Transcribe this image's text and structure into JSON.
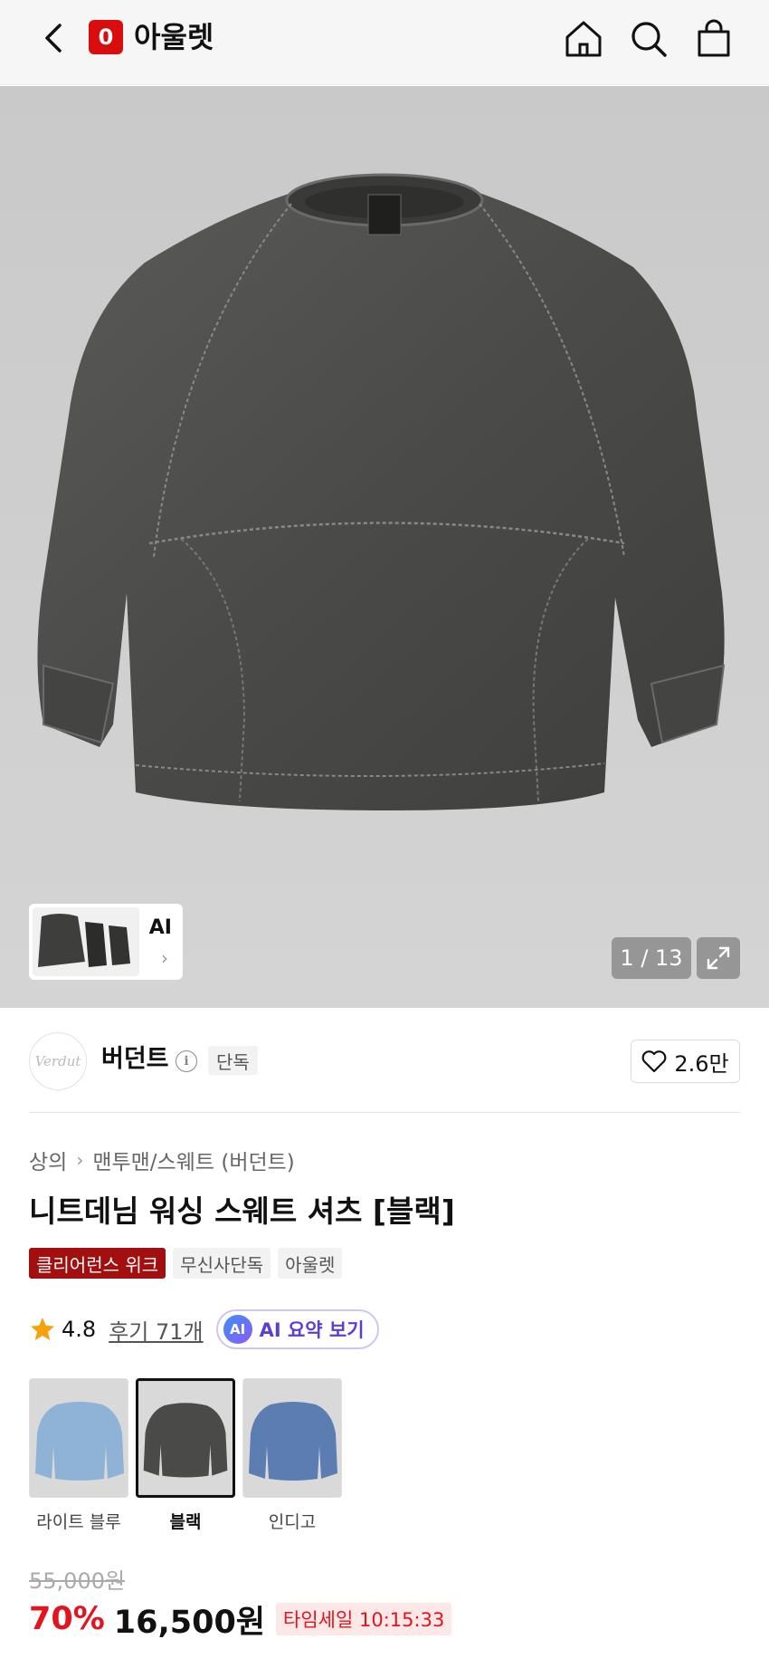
{
  "header": {
    "app_logo_letter": "0",
    "app_title": "아울렛",
    "icons": [
      "back-icon",
      "home-icon",
      "search-icon",
      "shopping-bag-icon"
    ]
  },
  "gallery": {
    "ai_label": "AI",
    "counter": "1 / 13"
  },
  "brand": {
    "logo_text": "Verdut",
    "name": "버던트",
    "badge": "단독",
    "likes": "2.6만"
  },
  "breadcrumb": {
    "category": "상의",
    "subcategory": "맨투맨/스웨트 (버던트)"
  },
  "product": {
    "title": "니트데님 워싱 스웨트 셔츠 [블랙]",
    "tags": [
      "클리어런스 위크",
      "무신사단독",
      "아울렛"
    ]
  },
  "rating": {
    "score": "4.8",
    "reviews": "후기 71개",
    "ai_badge": "AI",
    "ai_summary": "AI 요약 보기"
  },
  "colors": [
    {
      "name": "라이트 블루",
      "color": "#8fb3d6"
    },
    {
      "name": "블랙",
      "color": "#4a4a48"
    },
    {
      "name": "인디고",
      "color": "#5b7db2"
    }
  ],
  "price": {
    "original": "55,000원",
    "discount": "70%",
    "sale": "16,500원",
    "timesale": "타임세일 10:15:33"
  },
  "theme": {
    "accent_red": "#e3141f",
    "brand_red": "#d90d0d",
    "tag_red": "#a30e0e",
    "ai_purple": "#5b3fd1"
  }
}
